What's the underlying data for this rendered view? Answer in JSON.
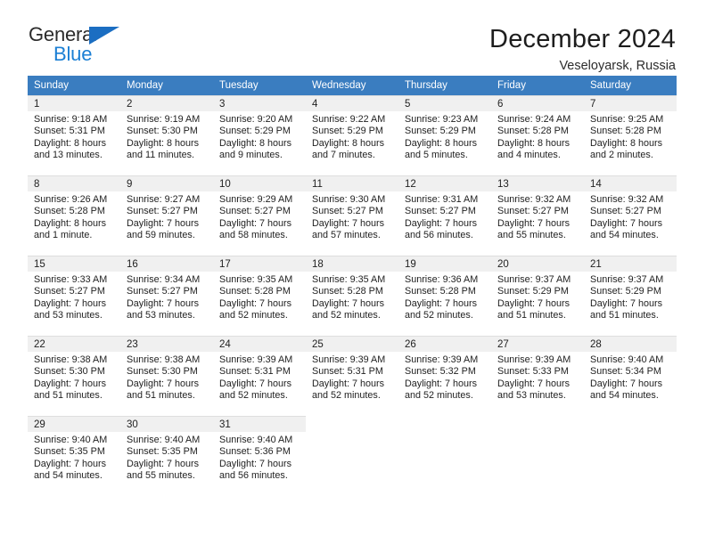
{
  "logo": {
    "word_top": "General",
    "word_bottom": "Blue",
    "triangle_color": "#1b6ec2",
    "blue_text_color": "#1b7fd4"
  },
  "header": {
    "title": "December 2024",
    "subtitle": "Veseloyarsk, Russia"
  },
  "theme": {
    "header_row_bg": "#3a7dc0",
    "day_number_bg": "#f0f0f0",
    "text_color": "#1f1f1f"
  },
  "calendar": {
    "weekday_headers": [
      "Sunday",
      "Monday",
      "Tuesday",
      "Wednesday",
      "Thursday",
      "Friday",
      "Saturday"
    ],
    "weeks": [
      [
        {
          "day": "1",
          "sunrise": "Sunrise: 9:18 AM",
          "sunset": "Sunset: 5:31 PM",
          "daylight_line1": "Daylight: 8 hours",
          "daylight_line2": "and 13 minutes."
        },
        {
          "day": "2",
          "sunrise": "Sunrise: 9:19 AM",
          "sunset": "Sunset: 5:30 PM",
          "daylight_line1": "Daylight: 8 hours",
          "daylight_line2": "and 11 minutes."
        },
        {
          "day": "3",
          "sunrise": "Sunrise: 9:20 AM",
          "sunset": "Sunset: 5:29 PM",
          "daylight_line1": "Daylight: 8 hours",
          "daylight_line2": "and 9 minutes."
        },
        {
          "day": "4",
          "sunrise": "Sunrise: 9:22 AM",
          "sunset": "Sunset: 5:29 PM",
          "daylight_line1": "Daylight: 8 hours",
          "daylight_line2": "and 7 minutes."
        },
        {
          "day": "5",
          "sunrise": "Sunrise: 9:23 AM",
          "sunset": "Sunset: 5:29 PM",
          "daylight_line1": "Daylight: 8 hours",
          "daylight_line2": "and 5 minutes."
        },
        {
          "day": "6",
          "sunrise": "Sunrise: 9:24 AM",
          "sunset": "Sunset: 5:28 PM",
          "daylight_line1": "Daylight: 8 hours",
          "daylight_line2": "and 4 minutes."
        },
        {
          "day": "7",
          "sunrise": "Sunrise: 9:25 AM",
          "sunset": "Sunset: 5:28 PM",
          "daylight_line1": "Daylight: 8 hours",
          "daylight_line2": "and 2 minutes."
        }
      ],
      [
        {
          "day": "8",
          "sunrise": "Sunrise: 9:26 AM",
          "sunset": "Sunset: 5:28 PM",
          "daylight_line1": "Daylight: 8 hours",
          "daylight_line2": "and 1 minute."
        },
        {
          "day": "9",
          "sunrise": "Sunrise: 9:27 AM",
          "sunset": "Sunset: 5:27 PM",
          "daylight_line1": "Daylight: 7 hours",
          "daylight_line2": "and 59 minutes."
        },
        {
          "day": "10",
          "sunrise": "Sunrise: 9:29 AM",
          "sunset": "Sunset: 5:27 PM",
          "daylight_line1": "Daylight: 7 hours",
          "daylight_line2": "and 58 minutes."
        },
        {
          "day": "11",
          "sunrise": "Sunrise: 9:30 AM",
          "sunset": "Sunset: 5:27 PM",
          "daylight_line1": "Daylight: 7 hours",
          "daylight_line2": "and 57 minutes."
        },
        {
          "day": "12",
          "sunrise": "Sunrise: 9:31 AM",
          "sunset": "Sunset: 5:27 PM",
          "daylight_line1": "Daylight: 7 hours",
          "daylight_line2": "and 56 minutes."
        },
        {
          "day": "13",
          "sunrise": "Sunrise: 9:32 AM",
          "sunset": "Sunset: 5:27 PM",
          "daylight_line1": "Daylight: 7 hours",
          "daylight_line2": "and 55 minutes."
        },
        {
          "day": "14",
          "sunrise": "Sunrise: 9:32 AM",
          "sunset": "Sunset: 5:27 PM",
          "daylight_line1": "Daylight: 7 hours",
          "daylight_line2": "and 54 minutes."
        }
      ],
      [
        {
          "day": "15",
          "sunrise": "Sunrise: 9:33 AM",
          "sunset": "Sunset: 5:27 PM",
          "daylight_line1": "Daylight: 7 hours",
          "daylight_line2": "and 53 minutes."
        },
        {
          "day": "16",
          "sunrise": "Sunrise: 9:34 AM",
          "sunset": "Sunset: 5:27 PM",
          "daylight_line1": "Daylight: 7 hours",
          "daylight_line2": "and 53 minutes."
        },
        {
          "day": "17",
          "sunrise": "Sunrise: 9:35 AM",
          "sunset": "Sunset: 5:28 PM",
          "daylight_line1": "Daylight: 7 hours",
          "daylight_line2": "and 52 minutes."
        },
        {
          "day": "18",
          "sunrise": "Sunrise: 9:35 AM",
          "sunset": "Sunset: 5:28 PM",
          "daylight_line1": "Daylight: 7 hours",
          "daylight_line2": "and 52 minutes."
        },
        {
          "day": "19",
          "sunrise": "Sunrise: 9:36 AM",
          "sunset": "Sunset: 5:28 PM",
          "daylight_line1": "Daylight: 7 hours",
          "daylight_line2": "and 52 minutes."
        },
        {
          "day": "20",
          "sunrise": "Sunrise: 9:37 AM",
          "sunset": "Sunset: 5:29 PM",
          "daylight_line1": "Daylight: 7 hours",
          "daylight_line2": "and 51 minutes."
        },
        {
          "day": "21",
          "sunrise": "Sunrise: 9:37 AM",
          "sunset": "Sunset: 5:29 PM",
          "daylight_line1": "Daylight: 7 hours",
          "daylight_line2": "and 51 minutes."
        }
      ],
      [
        {
          "day": "22",
          "sunrise": "Sunrise: 9:38 AM",
          "sunset": "Sunset: 5:30 PM",
          "daylight_line1": "Daylight: 7 hours",
          "daylight_line2": "and 51 minutes."
        },
        {
          "day": "23",
          "sunrise": "Sunrise: 9:38 AM",
          "sunset": "Sunset: 5:30 PM",
          "daylight_line1": "Daylight: 7 hours",
          "daylight_line2": "and 51 minutes."
        },
        {
          "day": "24",
          "sunrise": "Sunrise: 9:39 AM",
          "sunset": "Sunset: 5:31 PM",
          "daylight_line1": "Daylight: 7 hours",
          "daylight_line2": "and 52 minutes."
        },
        {
          "day": "25",
          "sunrise": "Sunrise: 9:39 AM",
          "sunset": "Sunset: 5:31 PM",
          "daylight_line1": "Daylight: 7 hours",
          "daylight_line2": "and 52 minutes."
        },
        {
          "day": "26",
          "sunrise": "Sunrise: 9:39 AM",
          "sunset": "Sunset: 5:32 PM",
          "daylight_line1": "Daylight: 7 hours",
          "daylight_line2": "and 52 minutes."
        },
        {
          "day": "27",
          "sunrise": "Sunrise: 9:39 AM",
          "sunset": "Sunset: 5:33 PM",
          "daylight_line1": "Daylight: 7 hours",
          "daylight_line2": "and 53 minutes."
        },
        {
          "day": "28",
          "sunrise": "Sunrise: 9:40 AM",
          "sunset": "Sunset: 5:34 PM",
          "daylight_line1": "Daylight: 7 hours",
          "daylight_line2": "and 54 minutes."
        }
      ],
      [
        {
          "day": "29",
          "sunrise": "Sunrise: 9:40 AM",
          "sunset": "Sunset: 5:35 PM",
          "daylight_line1": "Daylight: 7 hours",
          "daylight_line2": "and 54 minutes."
        },
        {
          "day": "30",
          "sunrise": "Sunrise: 9:40 AM",
          "sunset": "Sunset: 5:35 PM",
          "daylight_line1": "Daylight: 7 hours",
          "daylight_line2": "and 55 minutes."
        },
        {
          "day": "31",
          "sunrise": "Sunrise: 9:40 AM",
          "sunset": "Sunset: 5:36 PM",
          "daylight_line1": "Daylight: 7 hours",
          "daylight_line2": "and 56 minutes."
        },
        {
          "day": "",
          "sunrise": "",
          "sunset": "",
          "daylight_line1": "",
          "daylight_line2": ""
        },
        {
          "day": "",
          "sunrise": "",
          "sunset": "",
          "daylight_line1": "",
          "daylight_line2": ""
        },
        {
          "day": "",
          "sunrise": "",
          "sunset": "",
          "daylight_line1": "",
          "daylight_line2": ""
        },
        {
          "day": "",
          "sunrise": "",
          "sunset": "",
          "daylight_line1": "",
          "daylight_line2": ""
        }
      ]
    ]
  }
}
